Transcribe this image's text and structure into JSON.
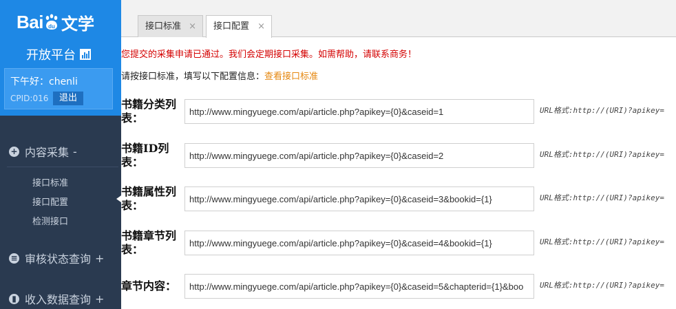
{
  "sidebar": {
    "logo_text": "Bai",
    "logo_du": "du",
    "logo_wenxue": "文学",
    "platform": "开放平台",
    "greeting": "下午好：chenli",
    "cpid": "CPID:016",
    "logout": "退出",
    "groups": [
      {
        "label": "内容采集",
        "sign": "-",
        "icon": "plus-circle-icon"
      },
      {
        "label": "审核状态查询",
        "sign": "+",
        "icon": "list-circle-icon"
      },
      {
        "label": "收入数据查询",
        "sign": "+",
        "icon": "chart-circle-icon"
      }
    ],
    "sub_items": [
      "接口标准",
      "接口配置",
      "检测接口"
    ]
  },
  "tabs": [
    {
      "label": "接口标准",
      "close": "×"
    },
    {
      "label": "接口配置",
      "close": "×"
    }
  ],
  "notice": "您提交的采集申请已通过。我们会定期接口采集。如需帮助，请联系商务！",
  "instruction": "请按接口标准，填写以下配置信息：",
  "instruction_link": "查看接口标准",
  "fields": [
    {
      "label": "书籍分类列表：",
      "value": "http://www.mingyuege.com/api/article.php?apikey={0}&caseid=1",
      "hint": "URL格式:http://(URI)?apikey="
    },
    {
      "label": "书籍ID列表：",
      "value": "http://www.mingyuege.com/api/article.php?apikey={0}&caseid=2",
      "hint": "URL格式:http://(URI)?apikey="
    },
    {
      "label": "书籍属性列表：",
      "value": "http://www.mingyuege.com/api/article.php?apikey={0}&caseid=3&bookid={1}",
      "hint": "URL格式:http://(URI)?apikey="
    },
    {
      "label": "书籍章节列表：",
      "value": "http://www.mingyuege.com/api/article.php?apikey={0}&caseid=4&bookid={1}",
      "hint": "URL格式:http://(URI)?apikey="
    },
    {
      "label": "章节内容：",
      "value": "http://www.mingyuege.com/api/article.php?apikey={0}&caseid=5&chapterid={1}&boo",
      "hint": "URL格式:http://(URI)?apikey="
    }
  ],
  "colors": {
    "brand_blue": "#1e88e5",
    "sidebar_bg": "#2a3a50",
    "notice_red": "#d40000",
    "link_orange": "#e5870f"
  }
}
